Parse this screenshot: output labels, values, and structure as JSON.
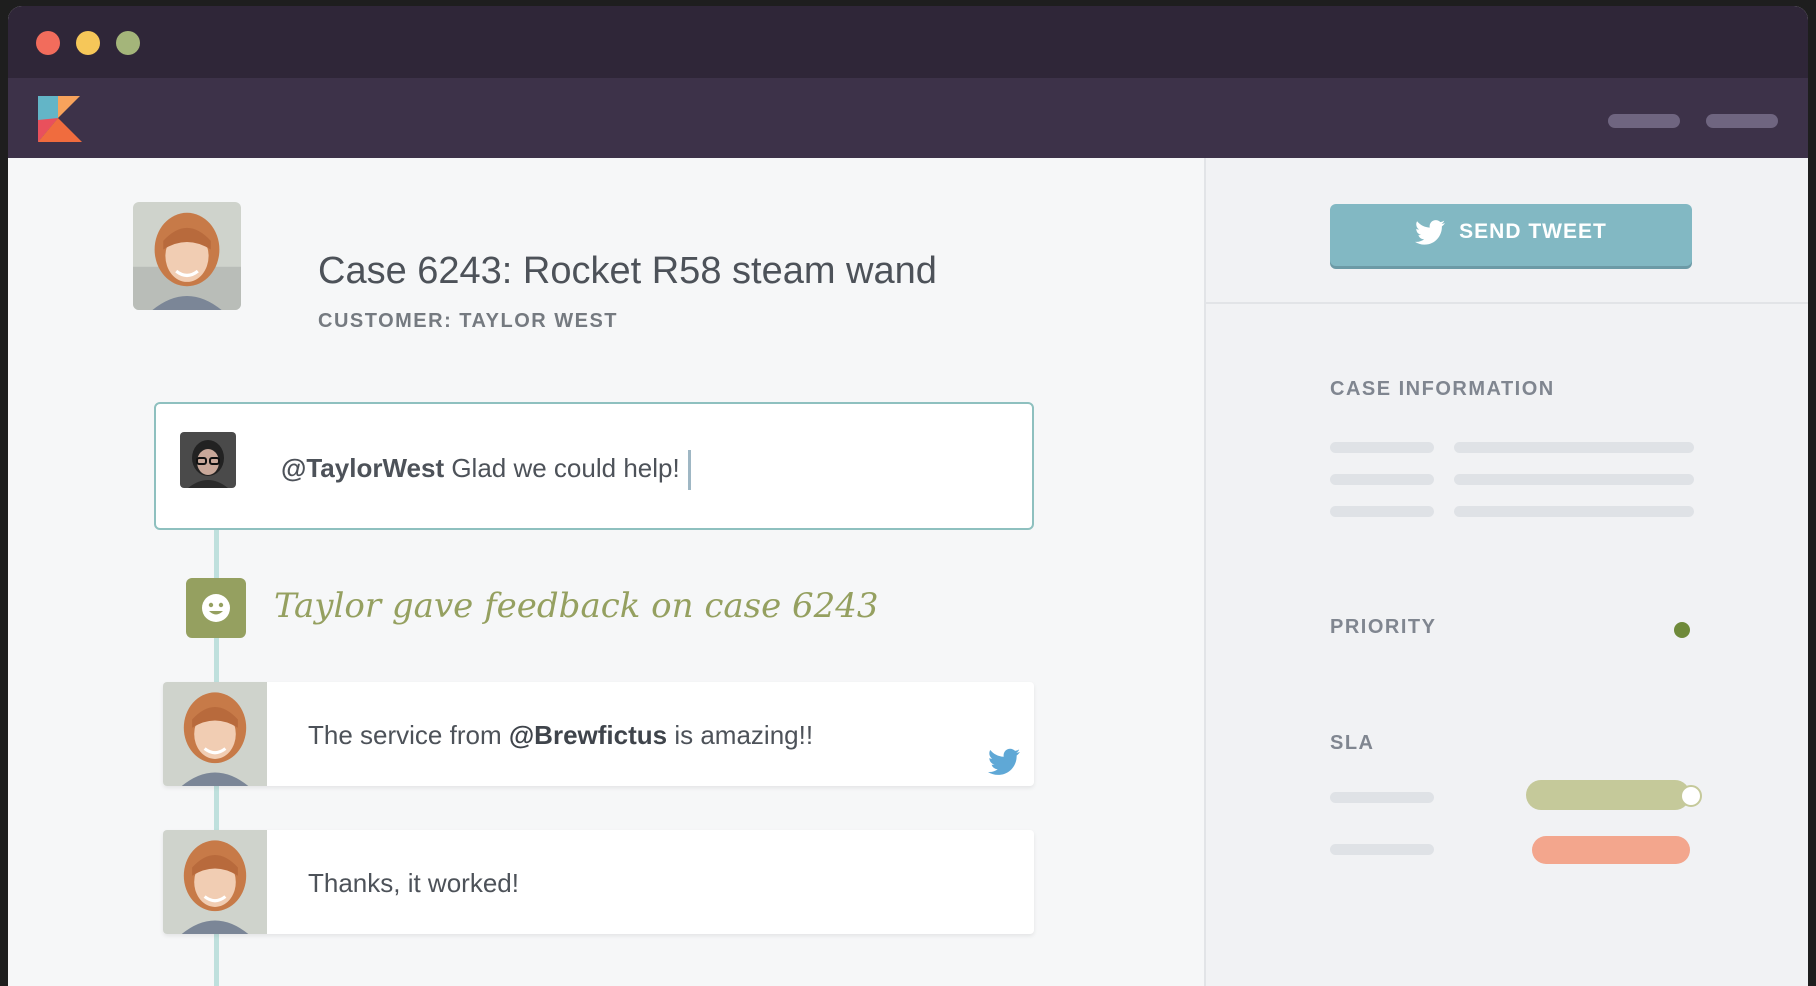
{
  "window": {
    "controls": [
      "close",
      "minimize",
      "maximize"
    ]
  },
  "colors": {
    "titlebar": "#2f2638",
    "appbar": "#3d3249",
    "accent_teal": "#82b8c3",
    "feedback_olive": "#95a060",
    "sla_red": "#f3a68d"
  },
  "appbar": {
    "logo_icon": "kayako-logo-icon"
  },
  "case": {
    "title": "Case 6243: Rocket R58 steam wand",
    "customer_label": "CUSTOMER: TAYLOR WEST"
  },
  "reply": {
    "mention": "@TaylorWest",
    "text": " Glad we could help!"
  },
  "feedback": {
    "icon": "smiley-icon",
    "text": "Taylor gave feedback on case 6243"
  },
  "messages": [
    {
      "prefix": "The service from ",
      "mention": "@Brewfictus",
      "suffix": " is amazing!!",
      "channel_icon": "twitter-icon"
    },
    {
      "text": "Thanks, it worked!"
    }
  ],
  "sidebar": {
    "send_button": "SEND TWEET",
    "case_information": "CASE INFORMATION",
    "priority": "PRIORITY",
    "sla": "SLA"
  }
}
